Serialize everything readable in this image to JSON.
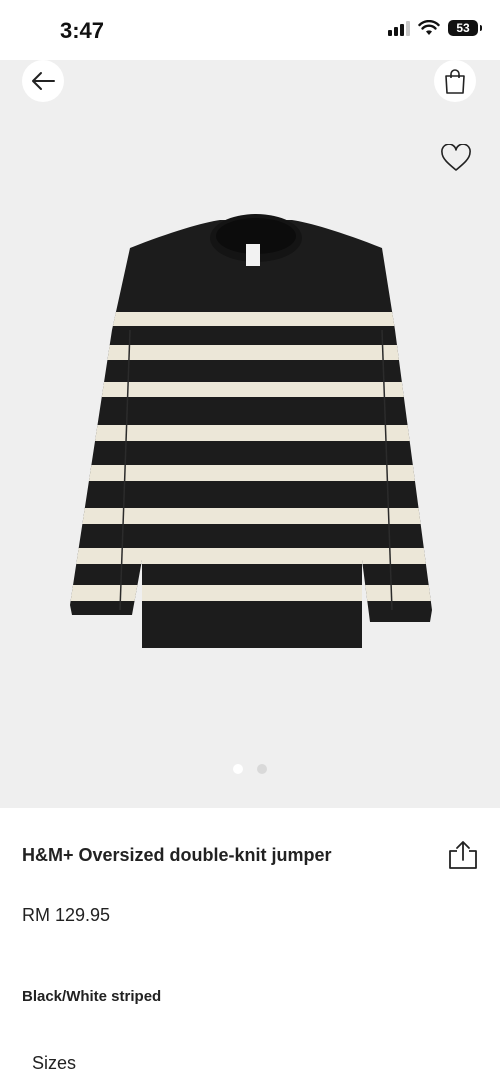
{
  "status_bar": {
    "time": "3:47",
    "battery": "53"
  },
  "gallery": {
    "dots": [
      {
        "active": true
      },
      {
        "active": false
      }
    ]
  },
  "product": {
    "title": "H&M+ Oversized double-knit jumper",
    "price": "RM 129.95",
    "color_name": "Black/White striped",
    "sizes_label": "Sizes"
  },
  "icons": {
    "back": "arrow-left-icon",
    "bag": "shopping-bag-icon",
    "wishlist": "heart-icon",
    "share": "share-icon"
  },
  "colors": {
    "sweater_black": "#1c1c1c",
    "stripe_cream": "#ece7d8",
    "image_bg": "#efefef"
  }
}
